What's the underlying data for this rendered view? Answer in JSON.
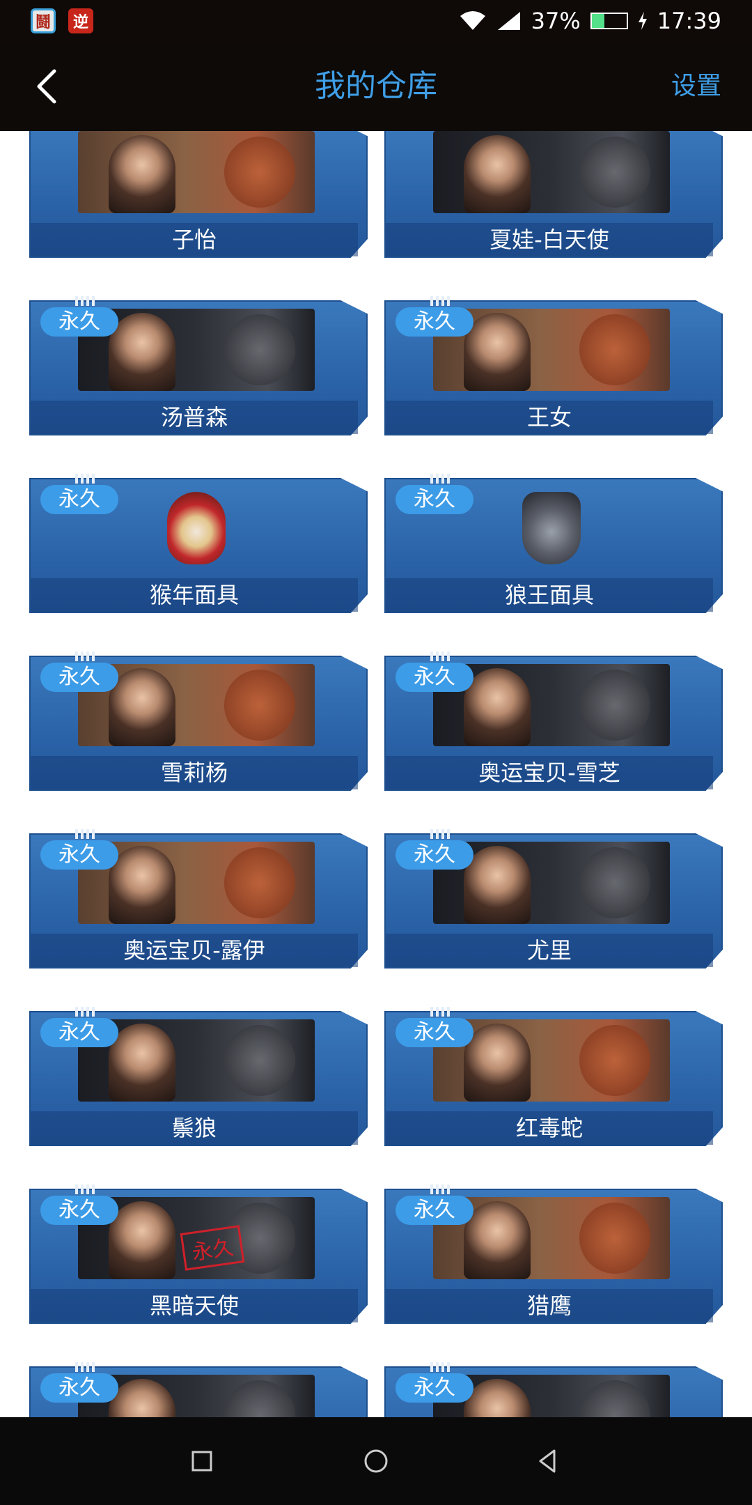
{
  "status_bar": {
    "app_icon_1_char": "鬪",
    "app_icon_2_char": "逆",
    "battery_text": "37%",
    "battery_level": 0.37,
    "time": "17:39"
  },
  "header": {
    "back_icon": "chevron-left-icon",
    "title": "我的仓库",
    "settings_label": "设置"
  },
  "warehouse": {
    "badge_label": "永久",
    "items": [
      {
        "name": "子怡",
        "style": "orange",
        "kind": "figure",
        "badge": false
      },
      {
        "name": "夏娃-白天使",
        "style": "dark",
        "kind": "figure",
        "badge": false
      },
      {
        "name": "汤普森",
        "style": "dark",
        "kind": "figure",
        "badge": true
      },
      {
        "name": "王女",
        "style": "orange",
        "kind": "figure",
        "badge": true
      },
      {
        "name": "猴年面具",
        "style": "none",
        "kind": "monkey",
        "badge": true
      },
      {
        "name": "狼王面具",
        "style": "none",
        "kind": "wolf",
        "badge": true
      },
      {
        "name": "雪莉杨",
        "style": "orange",
        "kind": "figure",
        "badge": true
      },
      {
        "name": "奥运宝贝-雪芝",
        "style": "dark",
        "kind": "figure",
        "badge": true
      },
      {
        "name": "奥运宝贝-露伊",
        "style": "orange",
        "kind": "figure",
        "badge": true
      },
      {
        "name": "尤里",
        "style": "dark",
        "kind": "figure",
        "badge": true
      },
      {
        "name": "鬃狼",
        "style": "dark",
        "kind": "figure",
        "badge": true
      },
      {
        "name": "红毒蛇",
        "style": "orange",
        "kind": "figure",
        "badge": true
      },
      {
        "name": "黑暗天使",
        "style": "dark",
        "kind": "figure",
        "badge": true,
        "stamp": "永久"
      },
      {
        "name": "猎鹰",
        "style": "orange",
        "kind": "figure",
        "badge": true
      },
      {
        "name": "",
        "style": "dark",
        "kind": "figure",
        "badge": true
      },
      {
        "name": "",
        "style": "dark",
        "kind": "figure",
        "badge": true
      }
    ]
  },
  "nav_bar": {
    "recents_icon": "square-icon",
    "home_icon": "circle-icon",
    "back_icon": "triangle-back-icon"
  }
}
